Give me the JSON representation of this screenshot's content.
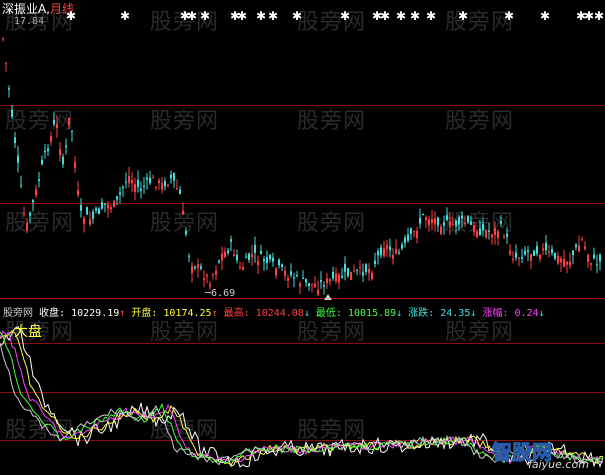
{
  "header": {
    "symbol": "深振业A",
    "period": "月线",
    "price_tag": "17.84"
  },
  "signals": [
    "✱",
    "✱",
    "✱",
    "✱",
    "✱",
    "✱",
    "✱",
    "✱",
    "✱",
    "✱",
    "✱",
    "✱",
    "✱",
    "✱",
    "✱",
    "✱",
    "✱",
    "✱",
    "✱",
    "✱",
    "✱",
    "✱"
  ],
  "stats": {
    "close_label": "收盘",
    "close_value": "10229.19",
    "open_label": "开盘",
    "open_value": "10174.25",
    "high_label": "最高",
    "high_value": "10244.08",
    "low_label": "最低",
    "low_value": "10015.89",
    "change_label": "涨跌",
    "change_value": "24.35",
    "amplitude_label": "涨幅",
    "amplitude_value": "0.24"
  },
  "annotations": {
    "low_marker": "6.69"
  },
  "indicator": {
    "name": "大盘"
  },
  "watermark": {
    "text": "股旁网",
    "logo_text": "智股网",
    "logo_url": "faiyue.com"
  },
  "colors": {
    "up": "#ff4040",
    "down": "#40e0e0",
    "grid": "#8a1010",
    "white": "#ffffff",
    "yellow": "#ffff40",
    "magenta": "#ff40ff",
    "green": "#40ff40"
  }
}
